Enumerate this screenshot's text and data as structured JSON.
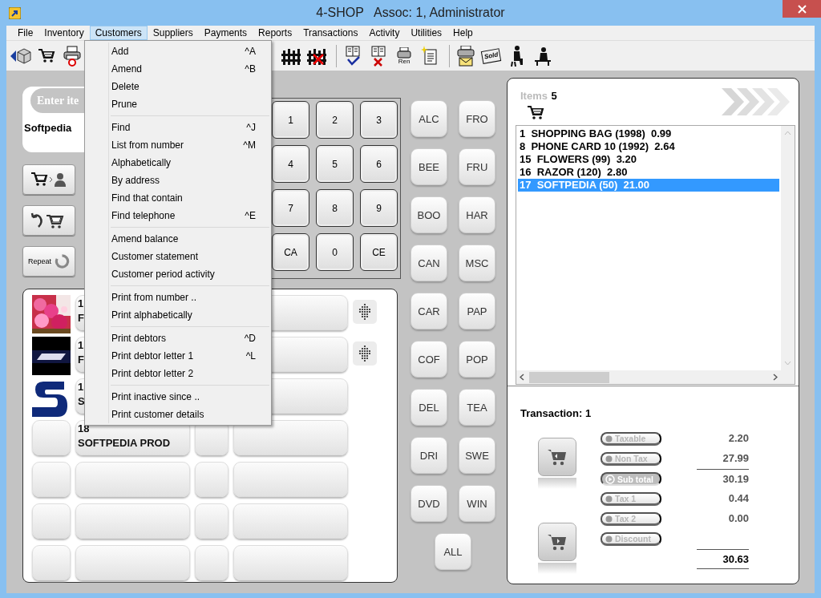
{
  "window": {
    "title": "4-SHOP",
    "subtitle": "Assoc: 1, Administrator"
  },
  "menu_bar": [
    {
      "label": "File",
      "selected": false
    },
    {
      "label": "Inventory",
      "selected": false
    },
    {
      "label": "Customers",
      "selected": true
    },
    {
      "label": "Suppliers",
      "selected": false
    },
    {
      "label": "Payments",
      "selected": false
    },
    {
      "label": "Reports",
      "selected": false
    },
    {
      "label": "Transactions",
      "selected": false
    },
    {
      "label": "Activity",
      "selected": false
    },
    {
      "label": "Utilities",
      "selected": false
    },
    {
      "label": "Help",
      "selected": false
    }
  ],
  "toolbar": {
    "reprint_label": "Ren",
    "sold_label": "Sold"
  },
  "customers_menu": [
    [
      {
        "label": "Add",
        "shortcut": "^A"
      },
      {
        "label": "Amend",
        "shortcut": "^B"
      },
      {
        "label": "Delete"
      },
      {
        "label": "Prune"
      }
    ],
    [
      {
        "label": "Find",
        "shortcut": "^J"
      },
      {
        "label": "List from number",
        "shortcut": "^M"
      },
      {
        "label": "Alphabetically"
      },
      {
        "label": "By address"
      },
      {
        "label": "Find that contain"
      },
      {
        "label": "Find telephone",
        "shortcut": "^E"
      }
    ],
    [
      {
        "label": "Amend balance"
      },
      {
        "label": "Customer statement"
      },
      {
        "label": "Customer period activity"
      }
    ],
    [
      {
        "label": "Print from number .."
      },
      {
        "label": "Print alphabetically"
      }
    ],
    [
      {
        "label": "Print debtors",
        "shortcut": "^D"
      },
      {
        "label": "Print debtor letter 1",
        "shortcut": "^L"
      },
      {
        "label": "Print debtor letter 2"
      }
    ],
    [
      {
        "label": "Print inactive since .."
      },
      {
        "label": "Print customer details"
      }
    ]
  ],
  "entry": {
    "label": "Enter ite",
    "value": "Softpedia"
  },
  "side_buttons": {
    "repeat_label": "Repeat"
  },
  "keypad": [
    "1",
    "2",
    "3",
    "4",
    "5",
    "6",
    "7",
    "8",
    "9",
    "CA",
    "0",
    "CE"
  ],
  "categories": [
    "ALC",
    "FRO",
    "BEE",
    "FRU",
    "BOO",
    "HAR",
    "CAN",
    "MSC",
    "CAR",
    "PAP",
    "COF",
    "POP",
    "DEL",
    "TEA",
    "DRI",
    "SWE",
    "DVD",
    "WIN",
    "ALL"
  ],
  "products": [
    {
      "kind": "picture",
      "number": "1",
      "name": "F",
      "dial": true
    },
    {
      "kind": "picture",
      "number": "1",
      "name": "F",
      "dial": true
    },
    {
      "kind": "picture",
      "number": "1",
      "name": "S",
      "dial": false
    },
    {
      "kind": "button",
      "number": "18",
      "name": "SOFTPEDIA PROD",
      "dial": false
    },
    {
      "kind": "button",
      "dial": false
    },
    {
      "kind": "button",
      "dial": false
    },
    {
      "kind": "button",
      "dial": false
    }
  ],
  "items_panel": {
    "label": "Items",
    "count": "5"
  },
  "items": [
    {
      "text": "1  SHOPPING BAG (1998)  0.99",
      "selected": false
    },
    {
      "text": "8  PHONE CARD 10 (1992)  2.64",
      "selected": false
    },
    {
      "text": "15  FLOWERS (99)  3.20",
      "selected": false
    },
    {
      "text": "16  RAZOR (120)  2.80",
      "selected": false
    },
    {
      "text": "17  SOFTPEDIA (50)  21.00",
      "selected": true
    }
  ],
  "transaction": "Transaction: 1",
  "totals": [
    {
      "label": "Taxable",
      "value": "2.20",
      "kind": "plain"
    },
    {
      "label": "Non Tax",
      "value": "27.99",
      "kind": "plain"
    },
    {
      "label": "Sub total",
      "value": "30.19",
      "kind": "subtotal"
    },
    {
      "label": "Tax 1",
      "value": "0.44",
      "kind": "plain"
    },
    {
      "label": "Tax 2",
      "value": "0.00",
      "kind": "plain"
    },
    {
      "label": "Discount",
      "kind": "plain"
    }
  ],
  "grand_total": "30.63"
}
